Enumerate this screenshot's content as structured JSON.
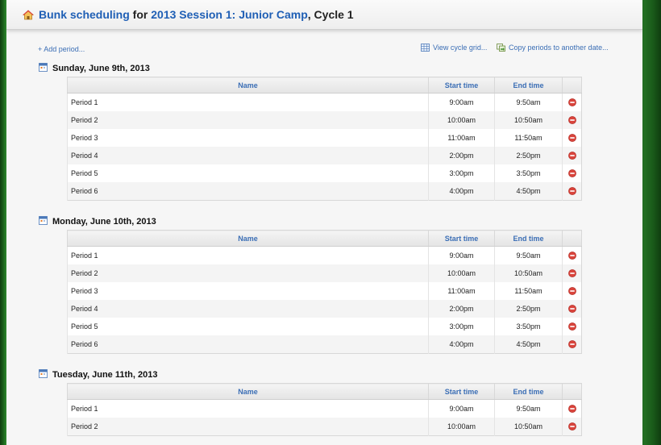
{
  "header": {
    "title_prefix": "Bunk scheduling",
    "title_for": " for ",
    "title_session": "2013 Session 1: Junior Camp",
    "title_suffix": ", Cycle 1"
  },
  "toolbar": {
    "add_period": "+ Add period...",
    "view_cycle_grid": "View cycle grid...",
    "copy_periods": "Copy periods to another date..."
  },
  "columns": {
    "name": "Name",
    "start": "Start time",
    "end": "End time"
  },
  "days": [
    {
      "title": "Sunday, June 9th, 2013",
      "periods": [
        {
          "name": "Period 1",
          "start": "9:00am",
          "end": "9:50am"
        },
        {
          "name": "Period 2",
          "start": "10:00am",
          "end": "10:50am"
        },
        {
          "name": "Period 3",
          "start": "11:00am",
          "end": "11:50am"
        },
        {
          "name": "Period 4",
          "start": "2:00pm",
          "end": "2:50pm"
        },
        {
          "name": "Period 5",
          "start": "3:00pm",
          "end": "3:50pm"
        },
        {
          "name": "Period 6",
          "start": "4:00pm",
          "end": "4:50pm"
        }
      ]
    },
    {
      "title": "Monday, June 10th, 2013",
      "periods": [
        {
          "name": "Period 1",
          "start": "9:00am",
          "end": "9:50am"
        },
        {
          "name": "Period 2",
          "start": "10:00am",
          "end": "10:50am"
        },
        {
          "name": "Period 3",
          "start": "11:00am",
          "end": "11:50am"
        },
        {
          "name": "Period 4",
          "start": "2:00pm",
          "end": "2:50pm"
        },
        {
          "name": "Period 5",
          "start": "3:00pm",
          "end": "3:50pm"
        },
        {
          "name": "Period 6",
          "start": "4:00pm",
          "end": "4:50pm"
        }
      ]
    },
    {
      "title": "Tuesday, June 11th, 2013",
      "periods": [
        {
          "name": "Period 1",
          "start": "9:00am",
          "end": "9:50am"
        },
        {
          "name": "Period 2",
          "start": "10:00am",
          "end": "10:50am"
        }
      ]
    }
  ],
  "colors": {
    "link": "#1f5fb5",
    "delete": "#d9443c",
    "background": "#226e22"
  }
}
